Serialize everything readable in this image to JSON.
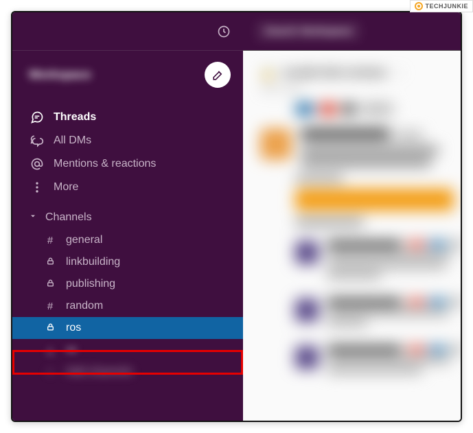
{
  "watermark": {
    "text": "TECHJUNKIE"
  },
  "workspace": {
    "name_blurred": "Workspace"
  },
  "nav": {
    "threads": "Threads",
    "all_dms": "All DMs",
    "mentions": "Mentions & reactions",
    "more": "More"
  },
  "sections": {
    "channels_label": "Channels"
  },
  "channels": [
    {
      "icon": "#",
      "name": "general",
      "selected": false,
      "private": false
    },
    {
      "icon": "lock",
      "name": "linkbuilding",
      "selected": false,
      "private": true
    },
    {
      "icon": "lock",
      "name": "publishing",
      "selected": false,
      "private": true
    },
    {
      "icon": "#",
      "name": "random",
      "selected": false,
      "private": false
    },
    {
      "icon": "lock",
      "name": "ros",
      "selected": true,
      "private": true
    }
  ],
  "blurred_trailing_items_count": 2,
  "search": {
    "placeholder_blurred": "Search Workspace"
  },
  "main_blur": {
    "channel_title": "rosalie-feb-reviews",
    "subtitle": "Add a topic"
  }
}
